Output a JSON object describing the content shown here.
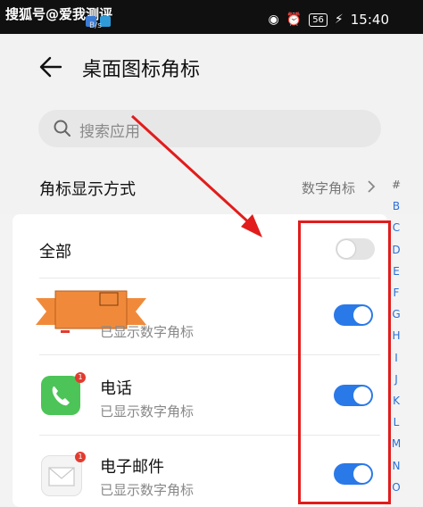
{
  "watermark": "搜狐号@爱我测评",
  "status_bar": {
    "speed": "B/s",
    "battery": "56",
    "time": "15:40",
    "icons": [
      "sim-icon",
      "signal-icon",
      "wifi-icon",
      "app-notify-icon",
      "vibrate-icon",
      "alarm-icon",
      "battery-icon",
      "charging-icon"
    ]
  },
  "header": {
    "title": "桌面图标角标"
  },
  "search": {
    "placeholder": "搜索应用"
  },
  "badge_mode": {
    "label": "角标显示方式",
    "value": "数字角标"
  },
  "all_row": {
    "label": "全部",
    "enabled": false
  },
  "apps": [
    {
      "name": "",
      "subtitle": "已显示数字角标",
      "enabled": true,
      "badge": ""
    },
    {
      "name": "电话",
      "subtitle": "已显示数字角标",
      "enabled": true,
      "badge": "1"
    },
    {
      "name": "电子邮件",
      "subtitle": "已显示数字角标",
      "enabled": true,
      "badge": "1"
    }
  ],
  "alpha_index": [
    "#",
    "B",
    "C",
    "D",
    "E",
    "F",
    "G",
    "H",
    "I",
    "J",
    "K",
    "L",
    "M",
    "N",
    "O"
  ],
  "colors": {
    "accent": "#2a79e8",
    "annotation": "#e21c1c",
    "phone_green": "#4cc457",
    "sticker_orange": "#f08a3a"
  }
}
